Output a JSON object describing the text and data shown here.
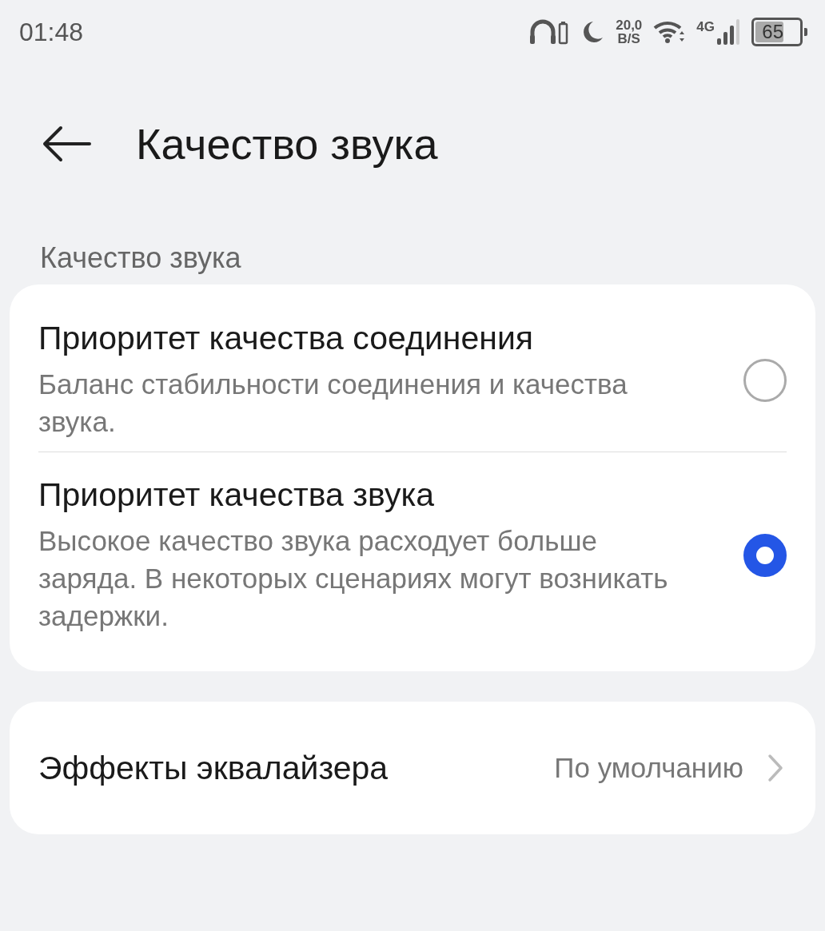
{
  "status_bar": {
    "time": "01:48",
    "speed": "20,0",
    "speed_unit": "B/S",
    "network": "4G",
    "battery": "65"
  },
  "header": {
    "title": "Качество звука"
  },
  "section": {
    "label": "Качество звука",
    "options": [
      {
        "title": "Приоритет качества соединения",
        "description": "Баланс стабильности соединения и качества звука.",
        "selected": false
      },
      {
        "title": "Приоритет качества звука",
        "description": "Высокое качество звука расходует больше заряда. В некоторых сценариях могут возникать задержки.",
        "selected": true
      }
    ]
  },
  "settings": [
    {
      "label": "Эффекты эквалайзера",
      "value": "По умолчанию"
    }
  ]
}
